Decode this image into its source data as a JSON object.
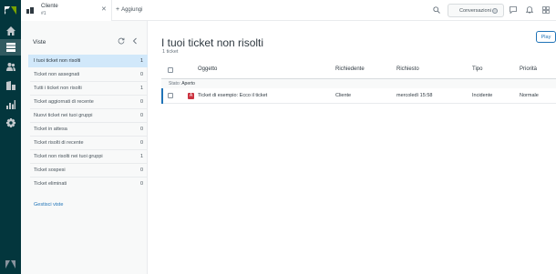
{
  "nav": {
    "items": [
      "home-icon",
      "views-icon",
      "customers-icon",
      "organizations-icon",
      "reporting-icon",
      "admin-icon"
    ]
  },
  "topbar": {
    "tab_title": "Cliente",
    "tab_subtitle": "#1",
    "add_label": "Aggiungi",
    "conversations_label": "Conversazioni"
  },
  "views": {
    "title": "Viste",
    "manage_label": "Gestisci viste",
    "items": [
      {
        "label": "I tuoi ticket non risolti",
        "count": "1"
      },
      {
        "label": "Ticket non assegnati",
        "count": "0"
      },
      {
        "label": "Tutti i ticket non risolti",
        "count": "1"
      },
      {
        "label": "Ticket aggiornati di recente",
        "count": "0"
      },
      {
        "label": "Nuovi ticket nei tuoi gruppi",
        "count": "0"
      },
      {
        "label": "Ticket in attesa",
        "count": "0"
      },
      {
        "label": "Ticket risolti di recente",
        "count": "0"
      },
      {
        "label": "Ticket non risolti nei tuoi gruppi",
        "count": "1"
      },
      {
        "label": "Ticket sospesi",
        "count": "0"
      },
      {
        "label": "Ticket eliminati",
        "count": "0"
      }
    ]
  },
  "main": {
    "title": "I tuoi ticket non risolti",
    "subtitle": "1 ticket",
    "play_label": "Play",
    "columns": {
      "subject": "Oggetto",
      "requester": "Richiedente",
      "requested": "Richiesto",
      "type": "Tipo",
      "priority": "Priorità"
    },
    "group": {
      "label": "Stato:",
      "value": "Aperto"
    },
    "rows": [
      {
        "status_letter": "A",
        "subject": "Ticket di esempio: Ecco il ticket",
        "requester": "Cliente",
        "requested": "mercoledì 15:58",
        "type": "Incidente",
        "priority": "Normale"
      }
    ]
  },
  "colors": {
    "rail": "#03363d",
    "selected_view": "#d1e8fa",
    "accent": "#1f73b7",
    "status_open": "#cc3340"
  }
}
